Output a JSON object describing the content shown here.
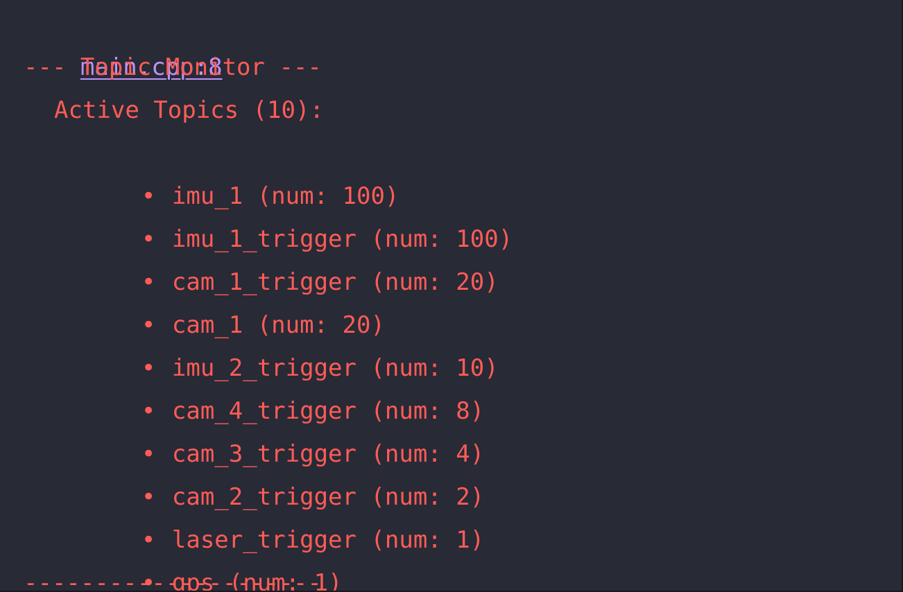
{
  "colors": {
    "background": "#282a36",
    "text": "#ff5c57",
    "link": "#bd93f9"
  },
  "console": {
    "source_link": "main.cpp:8",
    "header": "--- Topic Monitor ---",
    "active_topics_label": "Active Topics (10):",
    "bullet": "•",
    "topics": [
      "imu_1 (num: 100)",
      "imu_1_trigger (num: 100)",
      "cam_1_trigger (num: 20)",
      "cam_1 (num: 20)",
      "imu_2_trigger (num: 10)",
      "cam_4_trigger (num: 8)",
      "cam_3_trigger (num: 4)",
      "cam_2_trigger (num: 2)",
      "laser_trigger (num: 1)",
      "gps (num: 1)"
    ],
    "footer": "---------------------"
  }
}
